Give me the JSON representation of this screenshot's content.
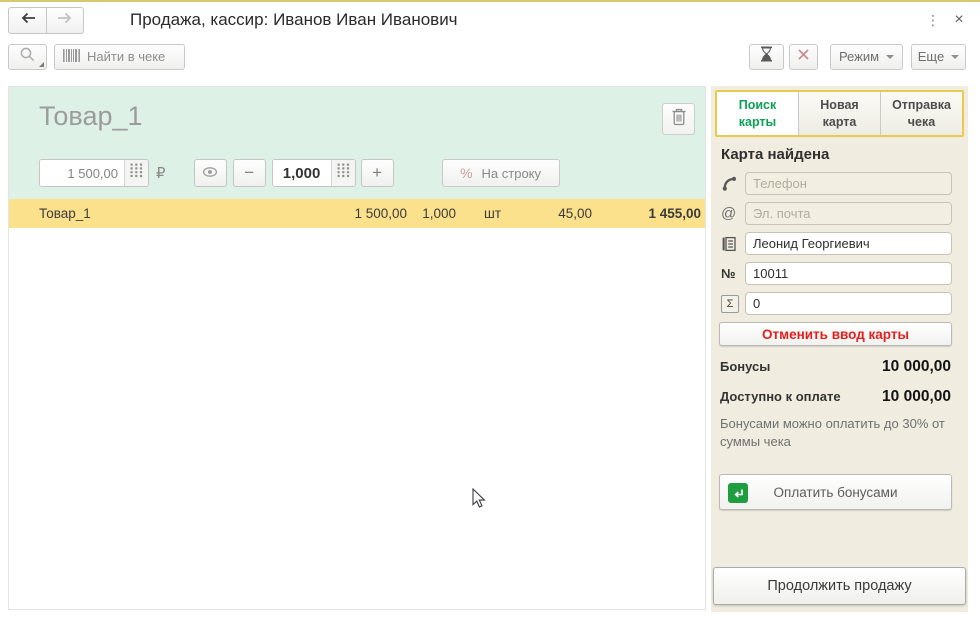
{
  "colors": {
    "accent_green": "#0FA058",
    "alert_red": "#E3201F",
    "row_highlight": "#FBE18C",
    "panel_green": "#DEF1E6",
    "sidebar_beige": "#F0EDE0",
    "tab_border_gold": "#EAC94F"
  },
  "icons": {
    "menu_dots": "⋮",
    "close": "×",
    "ruble": "₽",
    "minus": "−",
    "plus": "+",
    "percent": "%",
    "at": "@",
    "number_sign": "№",
    "sigma": "Σ"
  },
  "window": {
    "title": "Продажа, кассир: Иванов Иван Иванович"
  },
  "toolbar": {
    "find_in_receipt": "Найти в чеке",
    "mode": "Режим",
    "more": "Еще"
  },
  "product_panel": {
    "title": "Товар_1",
    "price": "1 500,00",
    "quantity": "1,000",
    "line_discount": "На строку"
  },
  "receipt_row": {
    "name": "Товар_1",
    "price": "1 500,00",
    "quantity": "1,000",
    "unit": "шт",
    "discount": "45,00",
    "total": "1 455,00"
  },
  "sidebar": {
    "tabs": [
      {
        "label": "Поиск карты"
      },
      {
        "label": "Новая карта"
      },
      {
        "label": "Отправка чека"
      }
    ],
    "status": "Карта найдена",
    "phone": {
      "placeholder": "Телефон"
    },
    "email": {
      "placeholder": "Эл. почта"
    },
    "holder": {
      "value": "Леонид Георгиевич"
    },
    "card_number": {
      "value": "10011"
    },
    "sum": {
      "value": "0"
    },
    "cancel_button": "Отменить ввод карты",
    "bonuses_label": "Бонусы",
    "bonuses_value": "10 000,00",
    "available_label": "Доступно к оплате",
    "available_value": "10 000,00",
    "note": "Бонусами можно оплатить до 30% от суммы чека",
    "pay_button": "Оплатить бонусами",
    "continue_button": "Продолжить продажу"
  }
}
